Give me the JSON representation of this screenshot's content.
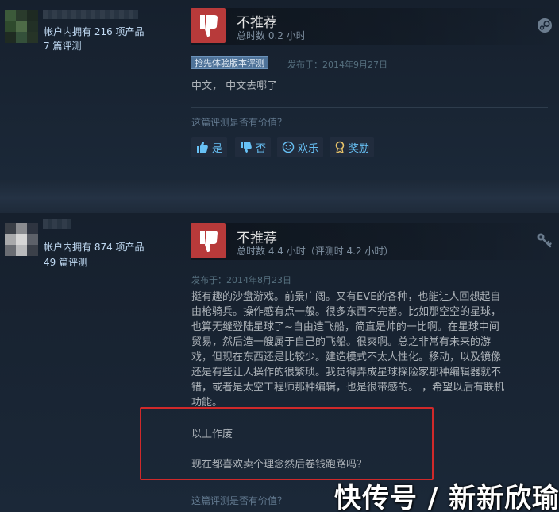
{
  "reviews": [
    {
      "account": {
        "products": "帐户内拥有 216 项产品",
        "reviews": "7 篇评测"
      },
      "verdict": "不推荐",
      "playtime": "总时数 0.2 小时",
      "badge": "抢先体验版本评测",
      "posted": "发布于：2014年9月27日",
      "body": [
        "中文， 中文去哪了"
      ],
      "helpful_prompt": "这篇评测是否有价值？",
      "buttons": {
        "yes": "是",
        "no": "否",
        "funny": "欢乐",
        "award": "奖励"
      },
      "corner_icon": "steam-icon"
    },
    {
      "account": {
        "products": "帐户内拥有 874 项产品",
        "reviews": "49 篇评测"
      },
      "verdict": "不推荐",
      "playtime": "总时数 4.4 小时（评测时 4.2 小时）",
      "posted": "发布于：2014年8月23日",
      "body": [
        "挺有趣的沙盘游戏。前景广阔。又有EVE的各种，也能让人回想起自",
        "由枪骑兵。操作感有点一般。很多东西不完善。比如那空空的星球，",
        "也算无缝登陆星球了~自由造飞船，简直是帅的一比啊。在星球中间",
        "贸易，然后造一艘属于自己的飞船。很爽啊。总之非常有未来的游",
        "戏，但现在东西还是比较少。建造模式不太人性化。移动，以及镜像",
        "还是有些让人操作的很繁琐。我觉得弄成星球探险家那种编辑器就不",
        "错，或者是太空工程师那种编辑，也是很带感的。 ，希望以后有联机",
        "功能。"
      ],
      "body_extra": [
        "以上作废",
        "现在都喜欢卖个理念然后卷钱跑路吗？"
      ],
      "helpful_prompt": "这篇评测是否有价值？",
      "corner_icon": "key-icon"
    }
  ],
  "watermark": "快传号 / 新新欣瑜",
  "colors": {
    "background": "#1b2838",
    "thumb_tile": "#b83a3a",
    "link": "#67c1f5",
    "highlight_border": "#d0292a"
  }
}
